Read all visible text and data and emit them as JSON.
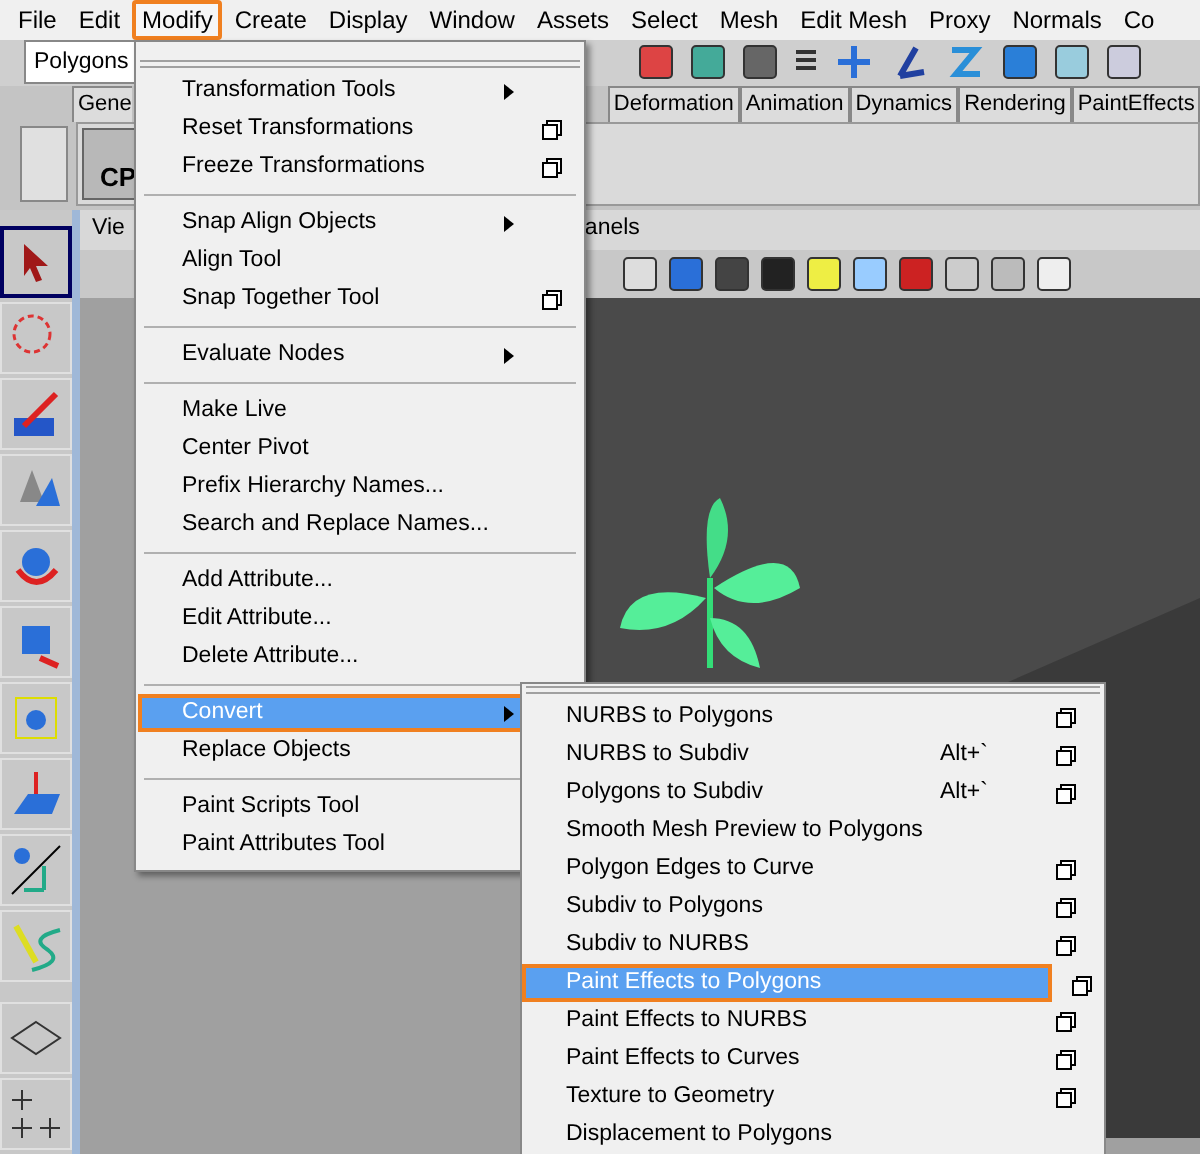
{
  "menubar": [
    {
      "label": "File",
      "selected": false
    },
    {
      "label": "Edit",
      "selected": false
    },
    {
      "label": "Modify",
      "selected": true
    },
    {
      "label": "Create",
      "selected": false
    },
    {
      "label": "Display",
      "selected": false
    },
    {
      "label": "Window",
      "selected": false
    },
    {
      "label": "Assets",
      "selected": false
    },
    {
      "label": "Select",
      "selected": false
    },
    {
      "label": "Mesh",
      "selected": false
    },
    {
      "label": "Edit Mesh",
      "selected": false
    },
    {
      "label": "Proxy",
      "selected": false
    },
    {
      "label": "Normals",
      "selected": false
    },
    {
      "label": "Co",
      "selected": false
    }
  ],
  "status_line": {
    "mode": "Polygons"
  },
  "shelf": {
    "tabs": [
      {
        "label": "Gene",
        "selected": false
      },
      {
        "label": "Deformation",
        "selected": false
      },
      {
        "label": "Animation",
        "selected": false
      },
      {
        "label": "Dynamics",
        "selected": false
      },
      {
        "label": "Rendering",
        "selected": false
      },
      {
        "label": "PaintEffects",
        "selected": false
      }
    ],
    "button_label": "CP"
  },
  "viewport": {
    "menu": [
      "Vie",
      "anels"
    ]
  },
  "modify_menu": {
    "sections": [
      [
        {
          "label": "Transformation Tools",
          "submenu": true,
          "options": false,
          "selected": false
        },
        {
          "label": "Reset Transformations",
          "submenu": false,
          "options": true,
          "selected": false
        },
        {
          "label": "Freeze Transformations",
          "submenu": false,
          "options": true,
          "selected": false
        }
      ],
      [
        {
          "label": "Snap Align Objects",
          "submenu": true,
          "options": false,
          "selected": false
        },
        {
          "label": "Align Tool",
          "submenu": false,
          "options": false,
          "selected": false
        },
        {
          "label": "Snap Together Tool",
          "submenu": false,
          "options": true,
          "selected": false
        }
      ],
      [
        {
          "label": "Evaluate Nodes",
          "submenu": true,
          "options": false,
          "selected": false
        }
      ],
      [
        {
          "label": "Make Live",
          "submenu": false,
          "options": false,
          "selected": false
        },
        {
          "label": "Center Pivot",
          "submenu": false,
          "options": false,
          "selected": false
        },
        {
          "label": "Prefix Hierarchy Names...",
          "submenu": false,
          "options": false,
          "selected": false
        },
        {
          "label": "Search and Replace Names...",
          "submenu": false,
          "options": false,
          "selected": false
        }
      ],
      [
        {
          "label": "Add Attribute...",
          "submenu": false,
          "options": false,
          "selected": false
        },
        {
          "label": "Edit Attribute...",
          "submenu": false,
          "options": false,
          "selected": false
        },
        {
          "label": "Delete Attribute...",
          "submenu": false,
          "options": false,
          "selected": false
        }
      ],
      [
        {
          "label": "Convert",
          "submenu": true,
          "selected": true
        },
        {
          "label": "Replace Objects",
          "submenu": false,
          "selected": false
        }
      ],
      [
        {
          "label": "Paint Scripts Tool",
          "submenu": false,
          "selected": false
        },
        {
          "label": "Paint Attributes Tool",
          "submenu": false,
          "selected": false
        }
      ]
    ]
  },
  "convert_submenu": {
    "items": [
      {
        "label": "NURBS to Polygons",
        "options": true,
        "selected": false
      },
      {
        "label": "NURBS to Subdiv",
        "shortcut": "Alt+`",
        "options": true,
        "selected": false
      },
      {
        "label": "Polygons to Subdiv",
        "shortcut": "Alt+`",
        "options": true,
        "selected": false
      },
      {
        "label": "Smooth Mesh Preview to Polygons",
        "options": false,
        "selected": false
      },
      {
        "label": "Polygon Edges to Curve",
        "options": true,
        "selected": false
      },
      {
        "label": "Subdiv to Polygons",
        "options": true,
        "selected": false
      },
      {
        "label": "Subdiv to NURBS",
        "options": true,
        "selected": false
      },
      {
        "label": "Paint Effects to Polygons",
        "options": true,
        "selected": true
      },
      {
        "label": "Paint Effects to NURBS",
        "options": true,
        "selected": false
      },
      {
        "label": "Paint Effects to Curves",
        "options": true,
        "selected": false
      },
      {
        "label": "Texture to Geometry",
        "options": true,
        "selected": false
      },
      {
        "label": "Displacement to Polygons",
        "options": false,
        "selected": false
      }
    ]
  }
}
